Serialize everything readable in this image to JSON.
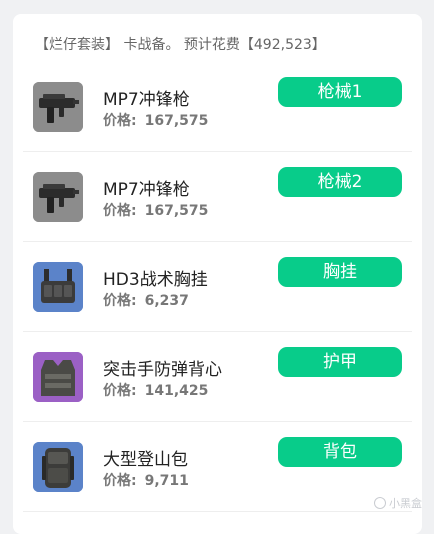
{
  "summary": {
    "text": "【烂仔套装】 卡战备。 预计花费【492,523】"
  },
  "price_label": "价格:",
  "items": [
    {
      "name": "MP7冲锋枪",
      "price": "167,575",
      "slot": "枪械1",
      "icon": "smg-icon",
      "tile_color": "#8a8a8a"
    },
    {
      "name": "MP7冲锋枪",
      "price": "167,575",
      "slot": "枪械2",
      "icon": "smg-icon",
      "tile_color": "#8a8a8a"
    },
    {
      "name": "HD3战术胸挂",
      "price": "6,237",
      "slot": "胸挂",
      "icon": "chest-rig-icon",
      "tile_color": "#5a82c8"
    },
    {
      "name": "突击手防弹背心",
      "price": "141,425",
      "slot": "护甲",
      "icon": "armor-vest-icon",
      "tile_color": "#9a5fc4"
    },
    {
      "name": "大型登山包",
      "price": "9,711",
      "slot": "背包",
      "icon": "backpack-icon",
      "tile_color": "#5a82c8"
    }
  ],
  "colors": {
    "accent_button": "#08cc8a",
    "page_background": "#f0f1f3",
    "card_background": "#ffffff"
  },
  "watermark": "小黑盒"
}
